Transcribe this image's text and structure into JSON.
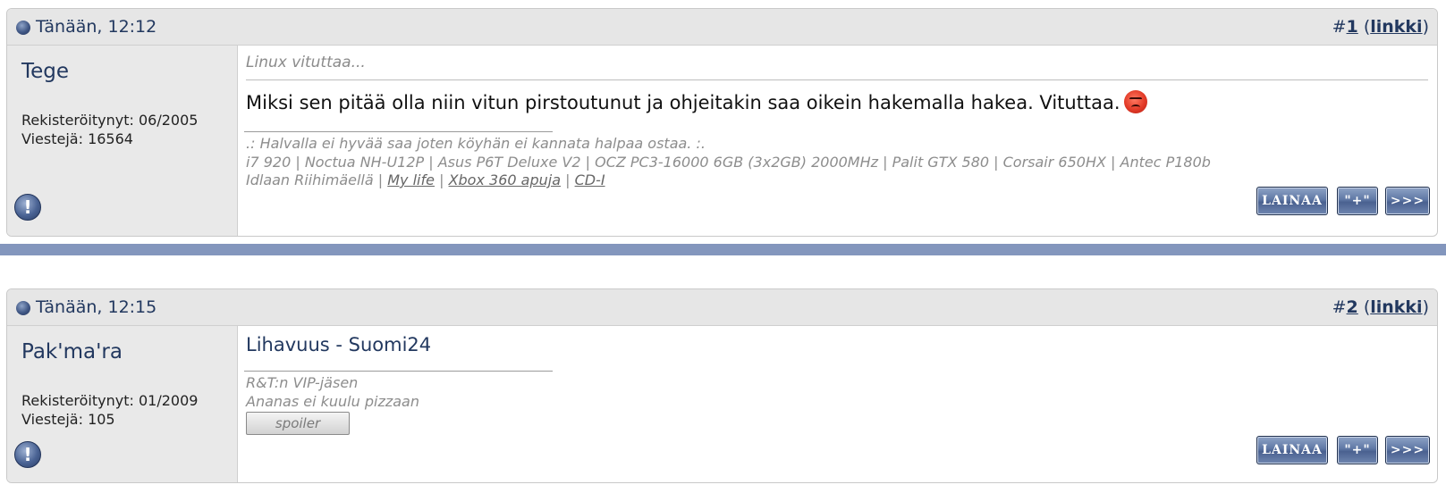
{
  "posts": [
    {
      "date": "Tänään, 12:12",
      "number_prefix": "#",
      "number": "1",
      "link_label": "linkki",
      "username": "Tege",
      "registered": "Rekisteröitynyt: 06/2005",
      "posts_count": "Viestejä: 16564",
      "title": "Linux vituttaa...",
      "body": "Miksi sen pitää olla niin vitun pirstoutunut ja ohjeitakin saa oikein hakemalla hakea. Vituttaa.",
      "emoji": "angry-face",
      "signature": {
        "line1": ".: Halvalla ei hyvää saa joten köyhän ei kannata halpaa ostaa. :.",
        "line2": "i7 920 | Noctua NH-U12P | Asus P6T Deluxe V2 | OCZ PC3-16000 6GB (3x2GB) 2000MHz | Palit GTX 580 | Corsair 650HX | Antec P180b",
        "line3_prefix": "Idlaan Riihimäellä |",
        "link1": "My life",
        "sep1": "|",
        "link2": "Xbox 360 apuja",
        "sep2": "|",
        "link3": "CD-I"
      }
    },
    {
      "date": "Tänään, 12:15",
      "number_prefix": "#",
      "number": "2",
      "link_label": "linkki",
      "username": "Pak'ma'ra",
      "registered": "Rekisteröitynyt: 01/2009",
      "posts_count": "Viestejä: 105",
      "title": "Lihavuus - Suomi24",
      "signature": {
        "line1": "R&T:n VIP-jäsen",
        "line2": "Ananas ei kuulu pizzaan"
      },
      "spoiler_label": "spoiler"
    }
  ],
  "buttons": {
    "quote": "LAINAA",
    "plus": "\"+\"",
    "more": ">>>"
  },
  "icons": {
    "status": "status-dot-icon",
    "report": "exclamation-icon"
  },
  "colors": {
    "header_bg": "#e6e6e6",
    "sidebar_bg": "#e9e9e9",
    "link_blue": "#22385f",
    "separator": "#8396bd",
    "button_blue": "#5f78a5"
  }
}
